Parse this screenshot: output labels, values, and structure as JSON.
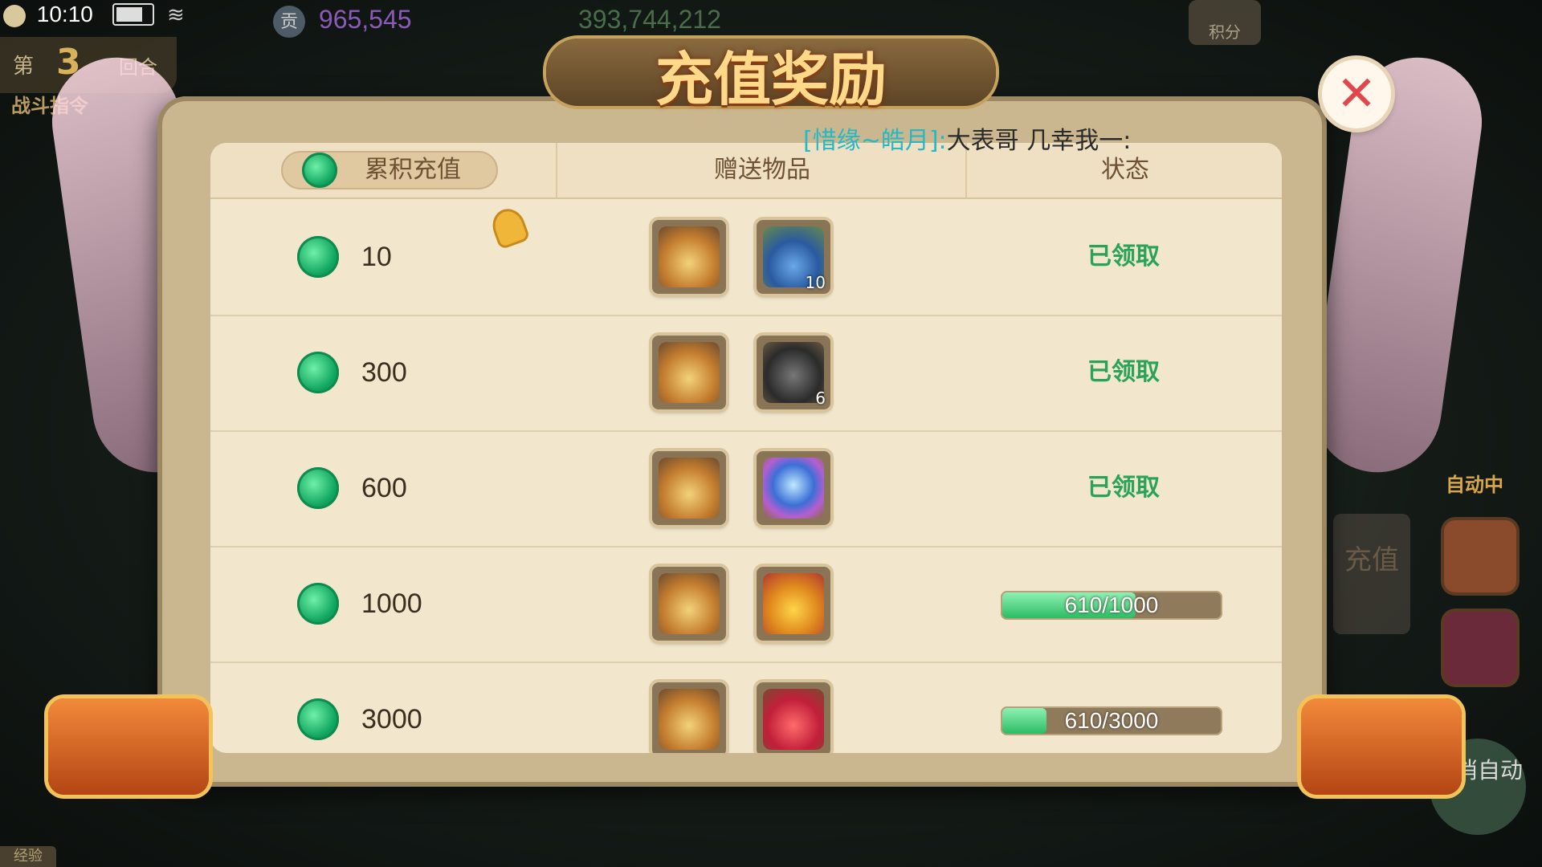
{
  "status_bar": {
    "time": "10:10",
    "currency_primary": "965,545",
    "currency_primary_icon_label": "贡",
    "currency_secondary": "393,744,212",
    "points_label": "积分"
  },
  "battle": {
    "round_prefix": "第",
    "round_number": "3",
    "round_suffix": "回合",
    "command_label": "战斗指令"
  },
  "dialog": {
    "title": "充值奖励",
    "close_symbol": "✕",
    "broadcast": {
      "speaker": "[惜缘~皓月]:",
      "message": "大表哥 几幸我一:"
    },
    "columns": {
      "recharge_tab": "累积充值",
      "gifts": "赠送物品",
      "status": "状态"
    },
    "rows": [
      {
        "amount": "10",
        "gift1_icon": "silver-bag-icon",
        "gift2_icon": "vase-icon",
        "gift2_qty": "10",
        "status": "已领取",
        "claimed": true
      },
      {
        "amount": "300",
        "gift1_icon": "silver-bag-icon",
        "gift2_icon": "ore-icon",
        "gift2_qty": "6",
        "status": "已领取",
        "claimed": true
      },
      {
        "amount": "600",
        "gift1_icon": "silver-bag-icon",
        "gift2_icon": "crystal-orb-icon",
        "gift2_qty": "",
        "status": "已领取",
        "claimed": true
      },
      {
        "amount": "1000",
        "gift1_icon": "silver-bag-icon",
        "gift2_icon": "lucky-pouch-icon",
        "gift2_qty": "",
        "progress_text": "610/1000",
        "progress": 0.61,
        "claimed": false
      },
      {
        "amount": "3000",
        "gift1_icon": "silver-bag-icon",
        "gift2_icon": "red-pouch-icon",
        "gift2_qty": "",
        "progress_text": "610/3000",
        "progress": 0.203,
        "claimed": false
      }
    ]
  },
  "side": {
    "auto_status": "自动中",
    "recharge_shortcut": "充值",
    "cancel_auto": "取消自动",
    "exp_tag": "经验"
  },
  "colors": {
    "claimed_green": "#2aa35a",
    "progress_fill": "#2bbd64",
    "title_gold": "#ffd98a",
    "broadcast_cyan": "#25b9c7"
  }
}
